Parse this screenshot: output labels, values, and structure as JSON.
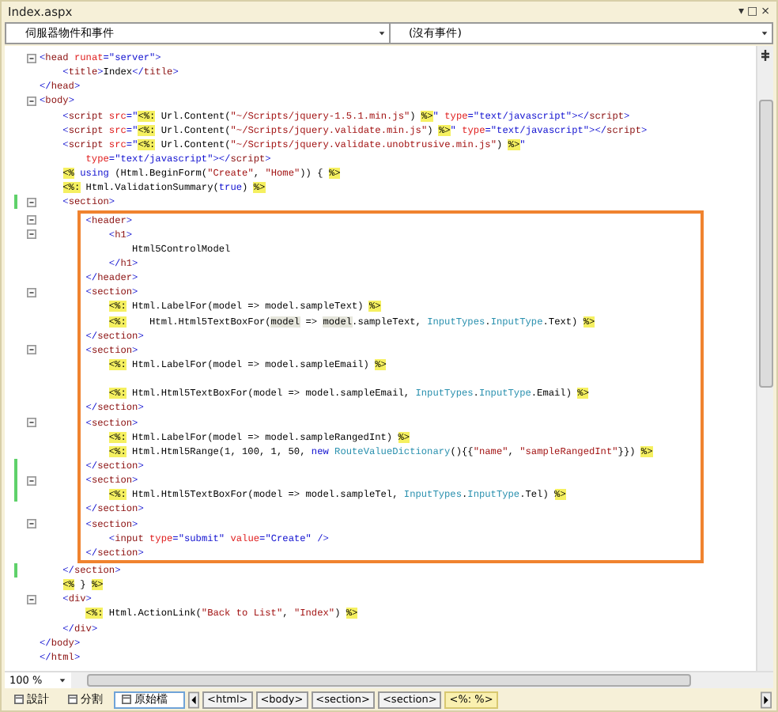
{
  "document_tab": {
    "title": "Index.aspx",
    "controls": [
      "▾",
      "□",
      "×"
    ]
  },
  "dropdowns": [
    {
      "value": "伺服器物件和事件"
    },
    {
      "value": "(沒有事件)"
    }
  ],
  "code_lines": [
    {
      "fold": true,
      "changed": false,
      "tokens": [
        {
          "kind": "punct",
          "text": "<"
        },
        {
          "kind": "tag",
          "text": "head"
        },
        {
          "kind": "attr",
          "text": " runat"
        },
        {
          "kind": "punct",
          "text": "=\"server\">"
        }
      ]
    },
    {
      "fold": false,
      "changed": false,
      "tokens": [
        {
          "kind": "punct",
          "text": "    <"
        },
        {
          "kind": "tag",
          "text": "title"
        },
        {
          "kind": "punct",
          "text": ">"
        },
        {
          "kind": "plain",
          "text": "Index"
        },
        {
          "kind": "punct",
          "text": "</"
        },
        {
          "kind": "tag",
          "text": "title"
        },
        {
          "kind": "punct",
          "text": ">"
        }
      ]
    },
    {
      "fold": false,
      "changed": false,
      "tokens": [
        {
          "kind": "punct",
          "text": "</"
        },
        {
          "kind": "tag",
          "text": "head"
        },
        {
          "kind": "punct",
          "text": ">"
        }
      ]
    },
    {
      "fold": true,
      "changed": false,
      "tokens": [
        {
          "kind": "punct",
          "text": "<"
        },
        {
          "kind": "tag",
          "text": "body"
        },
        {
          "kind": "punct",
          "text": ">"
        }
      ]
    },
    {
      "fold": false,
      "changed": false,
      "tokens": [
        {
          "kind": "punct",
          "text": "    <"
        },
        {
          "kind": "tag",
          "text": "script"
        },
        {
          "kind": "attr",
          "text": " src"
        },
        {
          "kind": "punct",
          "text": "=\""
        },
        {
          "kind": "delim",
          "text": "<%:"
        },
        {
          "kind": "plain",
          "text": " Url.Content("
        },
        {
          "kind": "string",
          "text": "\"~/Scripts/jquery-1.5.1.min.js\""
        },
        {
          "kind": "plain",
          "text": ") "
        },
        {
          "kind": "delim",
          "text": "%>"
        },
        {
          "kind": "punct",
          "text": "\""
        },
        {
          "kind": "attr",
          "text": " type"
        },
        {
          "kind": "punct",
          "text": "=\"text/javascript\"></"
        },
        {
          "kind": "tag",
          "text": "script"
        },
        {
          "kind": "punct",
          "text": ">"
        }
      ]
    },
    {
      "fold": false,
      "changed": false,
      "tokens": [
        {
          "kind": "punct",
          "text": "    <"
        },
        {
          "kind": "tag",
          "text": "script"
        },
        {
          "kind": "attr",
          "text": " src"
        },
        {
          "kind": "punct",
          "text": "=\""
        },
        {
          "kind": "delim",
          "text": "<%:"
        },
        {
          "kind": "plain",
          "text": " Url.Content("
        },
        {
          "kind": "string",
          "text": "\"~/Scripts/jquery.validate.min.js\""
        },
        {
          "kind": "plain",
          "text": ") "
        },
        {
          "kind": "delim",
          "text": "%>"
        },
        {
          "kind": "punct",
          "text": "\""
        },
        {
          "kind": "attr",
          "text": " type"
        },
        {
          "kind": "punct",
          "text": "=\"text/javascript\"></"
        },
        {
          "kind": "tag",
          "text": "script"
        },
        {
          "kind": "punct",
          "text": ">"
        }
      ]
    },
    {
      "fold": false,
      "changed": false,
      "tokens": [
        {
          "kind": "punct",
          "text": "    <"
        },
        {
          "kind": "tag",
          "text": "script"
        },
        {
          "kind": "attr",
          "text": " src"
        },
        {
          "kind": "punct",
          "text": "=\""
        },
        {
          "kind": "delim",
          "text": "<%:"
        },
        {
          "kind": "plain",
          "text": " Url.Content("
        },
        {
          "kind": "string",
          "text": "\"~/Scripts/jquery.validate.unobtrusive.min.js\""
        },
        {
          "kind": "plain",
          "text": ") "
        },
        {
          "kind": "delim",
          "text": "%>"
        },
        {
          "kind": "punct",
          "text": "\""
        }
      ]
    },
    {
      "fold": false,
      "changed": false,
      "tokens": [
        {
          "kind": "attr",
          "text": "        type"
        },
        {
          "kind": "punct",
          "text": "=\"text/javascript\"></"
        },
        {
          "kind": "tag",
          "text": "script"
        },
        {
          "kind": "punct",
          "text": ">"
        }
      ]
    },
    {
      "fold": false,
      "changed": false,
      "tokens": [
        {
          "kind": "delim",
          "text": "    <%"
        },
        {
          "kind": "keyword",
          "text": " using"
        },
        {
          "kind": "plain",
          "text": " (Html.BeginForm("
        },
        {
          "kind": "string",
          "text": "\"Create\""
        },
        {
          "kind": "plain",
          "text": ", "
        },
        {
          "kind": "string",
          "text": "\"Home\""
        },
        {
          "kind": "plain",
          "text": ")) { "
        },
        {
          "kind": "delim",
          "text": "%>"
        }
      ]
    },
    {
      "fold": false,
      "changed": false,
      "tokens": [
        {
          "kind": "delim",
          "text": "    <%:"
        },
        {
          "kind": "plain",
          "text": " Html.ValidationSummary("
        },
        {
          "kind": "keyword",
          "text": "true"
        },
        {
          "kind": "plain",
          "text": ") "
        },
        {
          "kind": "delim",
          "text": "%>"
        }
      ]
    },
    {
      "fold": true,
      "changed": true,
      "tokens": [
        {
          "kind": "punct",
          "text": "    <"
        },
        {
          "kind": "tag",
          "text": "section"
        },
        {
          "kind": "punct",
          "text": ">"
        }
      ]
    },
    {
      "kind": "highlight",
      "lines": [
        {
          "fold": true,
          "changed": false,
          "tokens": [
            {
              "kind": "punct",
              "text": "        <"
            },
            {
              "kind": "tag",
              "text": "header"
            },
            {
              "kind": "punct",
              "text": ">"
            }
          ]
        },
        {
          "fold": true,
          "changed": false,
          "tokens": [
            {
              "kind": "punct",
              "text": "            <"
            },
            {
              "kind": "tag",
              "text": "h1"
            },
            {
              "kind": "punct",
              "text": ">"
            }
          ]
        },
        {
          "fold": false,
          "changed": false,
          "tokens": [
            {
              "kind": "plain",
              "text": "                Html5ControlModel"
            }
          ]
        },
        {
          "fold": false,
          "changed": false,
          "tokens": [
            {
              "kind": "punct",
              "text": "            </"
            },
            {
              "kind": "tag",
              "text": "h1"
            },
            {
              "kind": "punct",
              "text": ">"
            }
          ]
        },
        {
          "fold": false,
          "changed": false,
          "tokens": [
            {
              "kind": "punct",
              "text": "        </"
            },
            {
              "kind": "tag",
              "text": "header"
            },
            {
              "kind": "punct",
              "text": ">"
            }
          ]
        },
        {
          "fold": true,
          "changed": false,
          "tokens": [
            {
              "kind": "punct",
              "text": "        <"
            },
            {
              "kind": "tag",
              "text": "section"
            },
            {
              "kind": "punct",
              "text": ">"
            }
          ]
        },
        {
          "fold": false,
          "changed": false,
          "tokens": [
            {
              "kind": "delim",
              "text": "            <%:"
            },
            {
              "kind": "plain",
              "text": " Html.LabelFor(model => model.sampleText) "
            },
            {
              "kind": "delim",
              "text": "%>"
            }
          ]
        },
        {
          "fold": false,
          "changed": false,
          "tokens": [
            {
              "kind": "delim",
              "text": "            <%:"
            },
            {
              "kind": "plain",
              "text": "    Html.Html5TextBoxFor("
            },
            {
              "kind": "ref",
              "text": "model"
            },
            {
              "kind": "plain",
              "text": " => "
            },
            {
              "kind": "ref",
              "text": "model"
            },
            {
              "kind": "plain",
              "text": ".sampleText, "
            },
            {
              "kind": "type",
              "text": "InputTypes"
            },
            {
              "kind": "plain",
              "text": "."
            },
            {
              "kind": "type",
              "text": "InputType"
            },
            {
              "kind": "plain",
              "text": ".Text) "
            },
            {
              "kind": "delim",
              "text": "%>"
            }
          ]
        },
        {
          "fold": false,
          "changed": false,
          "tokens": [
            {
              "kind": "punct",
              "text": "        </"
            },
            {
              "kind": "tag",
              "text": "section"
            },
            {
              "kind": "punct",
              "text": ">"
            }
          ]
        },
        {
          "fold": true,
          "changed": false,
          "tokens": [
            {
              "kind": "punct",
              "text": "        <"
            },
            {
              "kind": "tag",
              "text": "section"
            },
            {
              "kind": "punct",
              "text": ">"
            }
          ]
        },
        {
          "fold": false,
          "changed": false,
          "tokens": [
            {
              "kind": "delim",
              "text": "            <%:"
            },
            {
              "kind": "plain",
              "text": " Html.LabelFor(model => model.sampleEmail) "
            },
            {
              "kind": "delim",
              "text": "%>"
            }
          ]
        },
        {
          "fold": false,
          "changed": false
        },
        {
          "fold": false,
          "changed": false,
          "tokens": [
            {
              "kind": "delim",
              "text": "            <%:"
            },
            {
              "kind": "plain",
              "text": " Html.Html5TextBoxFor(model => model.sampleEmail, "
            },
            {
              "kind": "type",
              "text": "InputTypes"
            },
            {
              "kind": "plain",
              "text": "."
            },
            {
              "kind": "type",
              "text": "InputType"
            },
            {
              "kind": "plain",
              "text": ".Email) "
            },
            {
              "kind": "delim",
              "text": "%>"
            }
          ]
        },
        {
          "fold": false,
          "changed": false,
          "tokens": [
            {
              "kind": "punct",
              "text": "        </"
            },
            {
              "kind": "tag",
              "text": "section"
            },
            {
              "kind": "punct",
              "text": ">"
            }
          ]
        },
        {
          "fold": true,
          "changed": false,
          "tokens": [
            {
              "kind": "punct",
              "text": "        <"
            },
            {
              "kind": "tag",
              "text": "section"
            },
            {
              "kind": "punct",
              "text": ">"
            }
          ]
        },
        {
          "fold": false,
          "changed": false,
          "tokens": [
            {
              "kind": "delim",
              "text": "            <%:"
            },
            {
              "kind": "plain",
              "text": " Html.LabelFor(model => model.sampleRangedInt) "
            },
            {
              "kind": "delim",
              "text": "%>"
            }
          ]
        },
        {
          "fold": false,
          "changed": false,
          "tokens": [
            {
              "kind": "delim",
              "text": "            <%:"
            },
            {
              "kind": "plain",
              "text": " Html.Html5Range(1, 100, 1, 50, "
            },
            {
              "kind": "keyword",
              "text": "new"
            },
            {
              "kind": "type",
              "text": " RouteValueDictionary"
            },
            {
              "kind": "plain",
              "text": "(){{"
            },
            {
              "kind": "string",
              "text": "\"name\""
            },
            {
              "kind": "plain",
              "text": ", "
            },
            {
              "kind": "string",
              "text": "\"sampleRangedInt\""
            },
            {
              "kind": "plain",
              "text": "}}) "
            },
            {
              "kind": "delim",
              "text": "%>"
            }
          ]
        },
        {
          "fold": false,
          "changed": true,
          "tokens": [
            {
              "kind": "punct",
              "text": "        </"
            },
            {
              "kind": "tag",
              "text": "section"
            },
            {
              "kind": "punct",
              "text": ">"
            }
          ]
        },
        {
          "fold": true,
          "changed": true,
          "tokens": [
            {
              "kind": "punct",
              "text": "        <"
            },
            {
              "kind": "tag",
              "text": "section"
            },
            {
              "kind": "punct",
              "text": ">"
            }
          ]
        },
        {
          "fold": false,
          "changed": true,
          "tokens": [
            {
              "kind": "delim",
              "text": "            <%:"
            },
            {
              "kind": "plain",
              "text": " Html.Html5TextBoxFor(model => model.sampleTel, "
            },
            {
              "kind": "type",
              "text": "InputTypes"
            },
            {
              "kind": "plain",
              "text": "."
            },
            {
              "kind": "type",
              "text": "InputType"
            },
            {
              "kind": "plain",
              "text": ".Tel) "
            },
            {
              "kind": "delim",
              "text": "%>"
            }
          ]
        },
        {
          "fold": false,
          "changed": false,
          "tokens": [
            {
              "kind": "punct",
              "text": "        </"
            },
            {
              "kind": "tag",
              "text": "section"
            },
            {
              "kind": "punct",
              "text": ">"
            }
          ]
        },
        {
          "fold": true,
          "changed": false,
          "tokens": [
            {
              "kind": "punct",
              "text": "        <"
            },
            {
              "kind": "tag",
              "text": "section"
            },
            {
              "kind": "punct",
              "text": ">"
            }
          ]
        },
        {
          "fold": false,
          "changed": false,
          "tokens": [
            {
              "kind": "punct",
              "text": "            <"
            },
            {
              "kind": "tag",
              "text": "input"
            },
            {
              "kind": "attr",
              "text": " type"
            },
            {
              "kind": "punct",
              "text": "=\"submit\""
            },
            {
              "kind": "attr",
              "text": " value"
            },
            {
              "kind": "punct",
              "text": "=\"Create\" />"
            }
          ]
        },
        {
          "fold": false,
          "changed": false,
          "tokens": [
            {
              "kind": "punct",
              "text": "        </"
            },
            {
              "kind": "tag",
              "text": "section"
            },
            {
              "kind": "punct",
              "text": ">"
            }
          ]
        }
      ]
    },
    {
      "fold": false,
      "changed": true,
      "tokens": [
        {
          "kind": "punct",
          "text": "    </"
        },
        {
          "kind": "tag",
          "text": "section"
        },
        {
          "kind": "punct",
          "text": ">"
        }
      ]
    },
    {
      "fold": false,
      "changed": false,
      "tokens": [
        {
          "kind": "delim",
          "text": "    <%"
        },
        {
          "kind": "plain",
          "text": " } "
        },
        {
          "kind": "delim",
          "text": "%>"
        }
      ]
    },
    {
      "fold": true,
      "changed": false,
      "tokens": [
        {
          "kind": "punct",
          "text": "    <"
        },
        {
          "kind": "tag",
          "text": "div"
        },
        {
          "kind": "punct",
          "text": ">"
        }
      ]
    },
    {
      "fold": false,
      "changed": false,
      "tokens": [
        {
          "kind": "delim",
          "text": "        <%:"
        },
        {
          "kind": "plain",
          "text": " Html.ActionLink("
        },
        {
          "kind": "string",
          "text": "\"Back to List\""
        },
        {
          "kind": "plain",
          "text": ", "
        },
        {
          "kind": "string",
          "text": "\"Index\""
        },
        {
          "kind": "plain",
          "text": ") "
        },
        {
          "kind": "delim",
          "text": "%>"
        }
      ]
    },
    {
      "fold": false,
      "changed": false,
      "tokens": [
        {
          "kind": "punct",
          "text": "    </"
        },
        {
          "kind": "tag",
          "text": "div"
        },
        {
          "kind": "punct",
          "text": ">"
        }
      ]
    },
    {
      "fold": false,
      "changed": false,
      "tokens": [
        {
          "kind": "punct",
          "text": "</"
        },
        {
          "kind": "tag",
          "text": "body"
        },
        {
          "kind": "punct",
          "text": ">"
        }
      ]
    },
    {
      "fold": false,
      "changed": false,
      "tokens": [
        {
          "kind": "punct",
          "text": "</"
        },
        {
          "kind": "tag",
          "text": "html"
        },
        {
          "kind": "punct",
          "text": ">"
        }
      ]
    }
  ],
  "zoom": {
    "value": "100 %"
  },
  "view_tabs": [
    {
      "label": "設計",
      "selected": false
    },
    {
      "label": "分割",
      "selected": false
    },
    {
      "label": "原始檔",
      "selected": true
    }
  ],
  "tag_path": [
    {
      "label": "<html>",
      "selected": false
    },
    {
      "label": "<body>",
      "selected": false
    },
    {
      "label": "<section>",
      "selected": false
    },
    {
      "label": "<section>",
      "selected": false
    },
    {
      "label": "<%: %>",
      "selected": true
    }
  ]
}
